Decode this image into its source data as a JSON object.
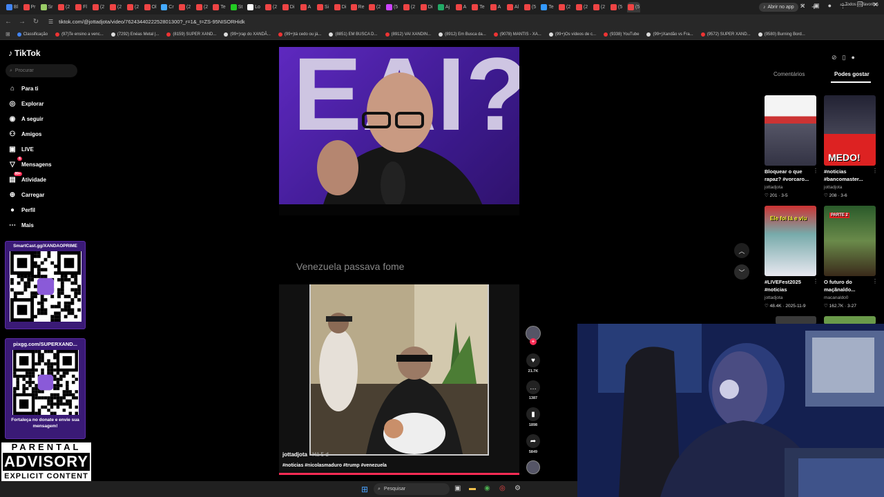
{
  "browser": {
    "url": "tiktok.com/@jottadjota/video/7624344022252801300?_r=1&_t=ZS-95NISORHidk",
    "open_in_app": "Abrir no app",
    "tab_labels": [
      "Bl",
      "Pr",
      "Sr",
      "(2",
      "Fl",
      "(2",
      "(2",
      "(2",
      "Ol",
      "Cr",
      "(2",
      "(2",
      "Te",
      "St",
      "Lo",
      "(2",
      "Di",
      "A",
      "Si",
      "Di",
      "Re",
      "(2",
      "(5",
      "(2",
      "Di",
      "Aj",
      "A",
      "Te",
      "A",
      "Al",
      "(5",
      "Te",
      "(2",
      "(2",
      "(2",
      "(5",
      "(5"
    ],
    "bookmarks": [
      "Classificação",
      "(97)Te ensino a venc...",
      "(7292) Enéas Metal |...",
      "(8159) SUPER XAND...",
      "(99+)rap do XANDÃ...",
      "(99+)tá cedo ou já...",
      "(8851) EM BUSCA D...",
      "(8912) VAI XANDIN...",
      "(8912) Em Busca da...",
      "(9078) MANTIS - XA...",
      "(99+)Os vídeos de c...",
      "(9338) YouTube",
      "(99+)Xandão vs Fra...",
      "(9572) SUPER XAND...",
      "(9580) Burning Bord..."
    ],
    "all_favorites": "Todos os favoritos"
  },
  "tiktok": {
    "logo": "TikTok",
    "search_placeholder": "Procurar",
    "nav": [
      {
        "label": "Para ti",
        "icon": "home-icon"
      },
      {
        "label": "Explorar",
        "icon": "compass-icon"
      },
      {
        "label": "A seguir",
        "icon": "following-icon"
      },
      {
        "label": "Amigos",
        "icon": "friends-icon"
      },
      {
        "label": "LIVE",
        "icon": "live-icon"
      },
      {
        "label": "Mensagens",
        "icon": "messages-icon",
        "badge": "6"
      },
      {
        "label": "Atividade",
        "icon": "activity-icon",
        "badge": "99+"
      },
      {
        "label": "Carregar",
        "icon": "upload-icon"
      },
      {
        "label": "Perfil",
        "icon": "profile-icon"
      },
      {
        "label": "Mais",
        "icon": "more-icon"
      }
    ]
  },
  "overlays": {
    "smartcast_title": "SmartCast.gg/XANDAOPRIME",
    "pix_title": "pixgg.com/SUPERXAND...",
    "pix_footer": "Fortaleça no donate e envie sua mensagem!",
    "parental_line1": "PARENTAL",
    "parental_line2": "ADVISORY",
    "parental_line3": "EXPLICIT CONTENT"
  },
  "video": {
    "caption_overlay": "Venezuela passava fome",
    "author": "jottadjota",
    "posted_ago": "· Há 5 d",
    "hashtags": "#noticias #nicolasmaduro #trump #venezuela",
    "likes": "21.7K",
    "comments": "1387",
    "saves": "1898",
    "shares": "5849"
  },
  "right_panel": {
    "tab_comments": "Comentários",
    "tab_suggested": "Podes gostar",
    "items": [
      {
        "title_line1": "Bloquear o que",
        "title_line2": "rapaz? #vorcaro...",
        "author": "jottadjota",
        "stats": "♡ 201 · 3-5"
      },
      {
        "title_line1": "#noticias",
        "title_line2": "#bancomaster...",
        "author": "jottadjota",
        "stats": "♡ 208 · 3-6",
        "thumb_label": "MEDO!"
      },
      {
        "title_line1": "#LIVEFest2025",
        "title_line2": "#noticias",
        "author": "jottadjota",
        "stats": "♡ 48.4K · 2025-11-9",
        "thumb_label": "Ele foi lá e viu"
      },
      {
        "title_line1": "O futuro do",
        "title_line2": "maçãnaldo...",
        "author": "macanaldo0",
        "stats": "♡ 162.7K · 3-27",
        "thumb_label": "PARTE 2"
      }
    ]
  },
  "taskbar": {
    "search_label": "Pesquisar"
  }
}
